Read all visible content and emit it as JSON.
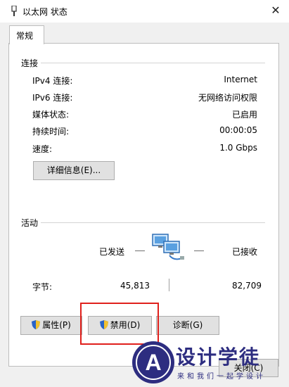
{
  "window": {
    "title": "以太网 状态",
    "close_symbol": "✕"
  },
  "tabs": [
    {
      "label": "常规"
    }
  ],
  "connection": {
    "heading": "连接",
    "rows": [
      {
        "label": "IPv4 连接:",
        "value": "Internet"
      },
      {
        "label": "IPv6 连接:",
        "value": "无网络访问权限"
      },
      {
        "label": "媒体状态:",
        "value": "已启用"
      },
      {
        "label": "持续时间:",
        "value": "00:00:05"
      },
      {
        "label": "速度:",
        "value": "1.0 Gbps"
      }
    ],
    "details_button": "详细信息(E)..."
  },
  "activity": {
    "heading": "活动",
    "sent_label": "已发送",
    "received_label": "已接收",
    "bytes_label": "字节:",
    "bytes_sent": "45,813",
    "bytes_received": "82,709"
  },
  "buttons": {
    "properties": "属性(P)",
    "disable": "禁用(D)",
    "diagnose": "诊断(G)",
    "close": "关闭(C)"
  },
  "watermark": {
    "title": "设计学徒",
    "subtitle": "来和我们一起学设计",
    "logo_letter": "A"
  },
  "colors": {
    "highlight": "#e0201c",
    "shield_blue": "#2a64c8",
    "shield_yellow": "#f2c12e",
    "watermark": "#2d2d80"
  }
}
